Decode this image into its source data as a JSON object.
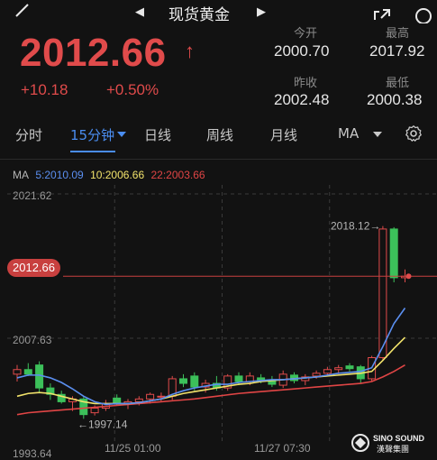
{
  "header": {
    "title": "现货黄金",
    "prev_icon": "chevron-left-icon",
    "next_icon": "chevron-right-icon"
  },
  "quote": {
    "price": "2012.66",
    "direction": "↑",
    "change": "+10.18",
    "change_pct": "+0.50%",
    "open_label": "今开",
    "open": "2000.70",
    "high_label": "最高",
    "high": "2017.92",
    "prev_close_label": "昨收",
    "prev_close": "2002.48",
    "low_label": "最低",
    "low": "2000.38"
  },
  "tabs": [
    "分时",
    "15分钟",
    "日线",
    "周线",
    "月线",
    "MA"
  ],
  "active_tab": "15分钟",
  "ma": {
    "label": "MA",
    "ma5": "5:2010.09",
    "ma10": "10:2006.66",
    "ma22": "22:2003.66"
  },
  "colors": {
    "up": "#e04b4b",
    "down": "#3cc05a",
    "accent": "#4a8df0",
    "ma5": "#5b8ff0",
    "ma10": "#f2e36b",
    "ma22": "#e04545"
  },
  "watermark": {
    "brand": "SINO SOUND",
    "sub": "漢聲集團"
  },
  "chart_data": {
    "type": "candlestick",
    "y_ticks": [
      "2021.62",
      "2007.63",
      "1993.64"
    ],
    "ylim": [
      1993.64,
      2021.62
    ],
    "x_ticks": [
      "11/25 01:00",
      "11/27 07:30"
    ],
    "current_price_label": "2012.66",
    "annotations": {
      "high": "2018.12→",
      "low": "←1997.14"
    },
    "candles": [
      [
        2002.0,
        2003.0,
        2001.2,
        2002.5
      ],
      [
        2002.5,
        2003.2,
        2001.8,
        2002.0
      ],
      [
        2003.0,
        2003.4,
        2000.0,
        2000.5
      ],
      [
        2000.5,
        2001.0,
        1999.2,
        1999.8
      ],
      [
        1999.8,
        2000.2,
        1998.8,
        1999.0
      ],
      [
        1999.0,
        1999.6,
        1998.0,
        1999.3
      ],
      [
        1999.3,
        1999.6,
        1997.14,
        1997.6
      ],
      [
        1997.8,
        1998.6,
        1997.5,
        1998.3
      ],
      [
        1998.3,
        1999.2,
        1998.0,
        1998.8
      ],
      [
        1999.4,
        1999.8,
        1998.6,
        1998.8
      ],
      [
        1998.8,
        1999.3,
        1998.2,
        1999.0
      ],
      [
        1999.0,
        1999.6,
        1998.6,
        1999.3
      ],
      [
        1999.3,
        2000.0,
        1998.8,
        1999.8
      ],
      [
        1999.6,
        2000.0,
        1999.0,
        1999.6
      ],
      [
        1999.6,
        2001.8,
        1999.2,
        2001.5
      ],
      [
        2001.5,
        2002.0,
        2000.6,
        2001.0
      ],
      [
        2001.8,
        2002.2,
        2000.2,
        2000.6
      ],
      [
        2000.6,
        2001.4,
        2000.0,
        2001.0
      ],
      [
        2001.0,
        2001.8,
        2000.2,
        2000.5
      ],
      [
        2000.5,
        2002.0,
        2000.2,
        2001.8
      ],
      [
        2001.8,
        2002.2,
        2000.8,
        2001.2
      ],
      [
        2001.2,
        2002.2,
        2000.8,
        2001.8
      ],
      [
        2001.6,
        2002.0,
        2001.0,
        2001.3
      ],
      [
        2001.4,
        2001.8,
        2000.6,
        2000.9
      ],
      [
        2000.8,
        2002.4,
        2000.5,
        2002.0
      ],
      [
        2001.9,
        2002.2,
        2001.0,
        2001.3
      ],
      [
        2001.3,
        2002.0,
        2000.8,
        2001.7
      ],
      [
        2001.8,
        2002.4,
        2001.5,
        2002.1
      ],
      [
        2002.1,
        2002.8,
        2001.8,
        2002.5
      ],
      [
        2002.5,
        2003.0,
        2002.0,
        2002.7
      ],
      [
        2002.9,
        2003.2,
        2002.3,
        2002.6
      ],
      [
        2002.8,
        2003.0,
        2001.0,
        2001.5
      ],
      [
        2001.5,
        2004.0,
        2001.2,
        2003.8
      ],
      [
        2003.8,
        2018.12,
        2003.5,
        2017.8
      ],
      [
        2017.8,
        2018.0,
        2012.0,
        2012.5
      ],
      [
        2012.5,
        2013.4,
        2012.0,
        2012.66
      ]
    ],
    "ma5": [
      2001.6,
      2001.9,
      2001.9,
      2001.6,
      2001.1,
      2000.4,
      1999.6,
      1999.0,
      1998.7,
      1998.8,
      1998.8,
      1998.9,
      1999.1,
      1999.3,
      1999.8,
      2000.2,
      2000.5,
      2000.7,
      2000.9,
      2000.9,
      2001.1,
      2001.2,
      2001.3,
      2001.4,
      2001.4,
      2001.5,
      2001.6,
      2001.7,
      2001.9,
      2002.1,
      2002.2,
      2002.3,
      2002.7,
      2005.0,
      2007.5,
      2009.2
    ],
    "ma10": [
      1999.6,
      1999.9,
      2000.0,
      1999.9,
      1999.6,
      1999.3,
      1999.0,
      1998.8,
      1998.8,
      1998.8,
      1998.8,
      1998.9,
      1999.1,
      1999.3,
      1999.6,
      1999.9,
      2000.1,
      2000.3,
      2000.5,
      2000.7,
      2000.9,
      2001.0,
      2001.2,
      2001.3,
      2001.4,
      2001.5,
      2001.6,
      2001.7,
      2001.8,
      2001.9,
      2002.0,
      2002.1,
      2002.3,
      2003.5,
      2004.8,
      2006.0
    ],
    "ma22": [
      1997.6,
      1997.8,
      1997.9,
      1998.0,
      1998.1,
      1998.2,
      1998.3,
      1998.4,
      1998.5,
      1998.6,
      1998.7,
      1998.8,
      1998.9,
      1999.0,
      1999.1,
      1999.2,
      1999.3,
      1999.45,
      1999.6,
      1999.75,
      1999.9,
      2000.0,
      2000.1,
      2000.2,
      2000.3,
      2000.4,
      2000.5,
      2000.6,
      2000.7,
      2000.8,
      2000.9,
      2001.0,
      2001.2,
      2001.7,
      2002.3,
      2003.0
    ]
  }
}
